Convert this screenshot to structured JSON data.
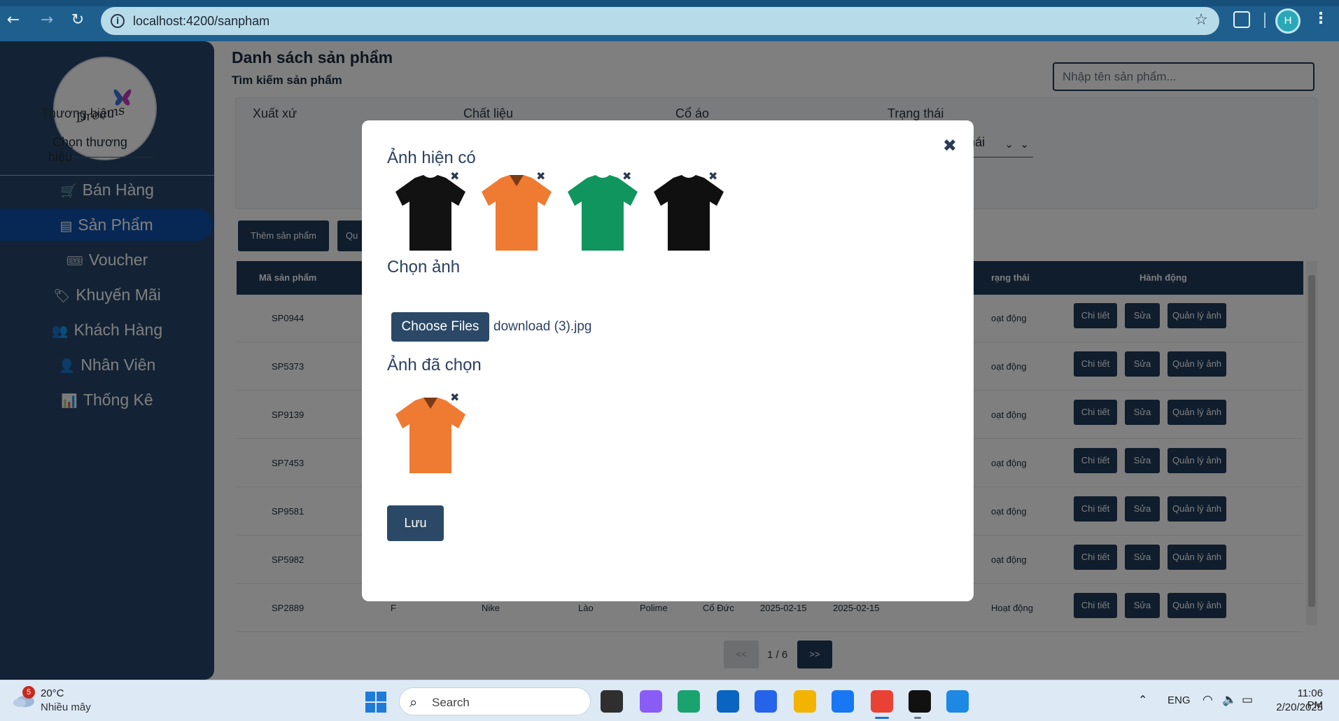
{
  "browser": {
    "url": "localhost:4200/sanpham",
    "profile_initial": "H"
  },
  "sidebar": {
    "logo_text": "Dreams",
    "items": [
      {
        "label": "Bán Hàng",
        "icon": "cart-icon",
        "glyph": "🛒"
      },
      {
        "label": "Sản Phẩm",
        "icon": "store-icon",
        "glyph": "▤"
      },
      {
        "label": "Voucher",
        "icon": "voucher-icon",
        "glyph": "🎟"
      },
      {
        "label": "Khuyến Mãi",
        "icon": "tag-icon",
        "glyph": "🏷"
      },
      {
        "label": "Khách Hàng",
        "icon": "users-icon",
        "glyph": "👥"
      },
      {
        "label": "Nhân Viên",
        "icon": "user-icon",
        "glyph": "👤"
      },
      {
        "label": "Thống Kê",
        "icon": "chart-icon",
        "glyph": "📊"
      }
    ],
    "active_index": 1
  },
  "page": {
    "title": "Danh sách sản phẩm",
    "subtitle": "Tìm kiếm sản phẩm",
    "search_placeholder": "Nhập tên sản phẩm...",
    "filters": [
      {
        "label": "Thương hiệu",
        "value": "Chọn thương hiệu"
      },
      {
        "label": "Xuất xứ",
        "value": ""
      },
      {
        "label": "Chất liệu",
        "value": ""
      },
      {
        "label": "Cổ áo",
        "value": ""
      },
      {
        "label": "Trạng thái",
        "value": "Chọn trạng thái"
      }
    ],
    "actions": [
      "Thêm sản phẩm",
      "Qu"
    ],
    "table_headers": [
      "Mã sản phẩm",
      "rạng thái",
      "Hành động"
    ],
    "rows": [
      {
        "code": "SP0944",
        "status": "oạt động"
      },
      {
        "code": "SP5373",
        "status": "oạt động"
      },
      {
        "code": "SP9139",
        "status": "oạt động"
      },
      {
        "code": "SP7453",
        "status": "oạt động"
      },
      {
        "code": "SP9581",
        "status": "oạt động"
      },
      {
        "code": "SP5982",
        "status": "oạt động"
      },
      {
        "code": "SP2889",
        "name": "F",
        "brand": "Nike",
        "origin": "Lào",
        "material": "Polime",
        "collar": "Cổ Đức",
        "created": "2025-02-15",
        "updated": "2025-02-15",
        "status": "Hoạt động"
      }
    ],
    "row_buttons": {
      "detail": "Chi tiết",
      "edit": "Sửa",
      "images": "Quản lý ảnh"
    },
    "pager": {
      "prev": "<<",
      "info": "1 / 6",
      "next": ">>"
    }
  },
  "modal": {
    "existing_heading": "Ảnh hiện có",
    "existing_images": [
      {
        "desc": "black t-shirt",
        "color": "#121212"
      },
      {
        "desc": "orange polo shirt",
        "color": "#ef7a32"
      },
      {
        "desc": "green t-shirt",
        "color": "#11955f"
      },
      {
        "desc": "black t-shirt",
        "color": "#101010"
      }
    ],
    "choose_heading": "Chọn ảnh",
    "choose_button": "Choose Files",
    "file_name": "download (3).jpg",
    "selected_heading": "Ảnh đã chọn",
    "selected_images": [
      {
        "desc": "orange polo shirt",
        "color": "#ef7a32"
      }
    ],
    "save_label": "Lưu",
    "close_glyph": "✖"
  },
  "taskbar": {
    "weather_badge": "5",
    "temperature": "20°C",
    "weather_desc": "Nhiều mây",
    "search_label": "Search",
    "language": "ENG",
    "time": "11:06 PM",
    "date": "2/20/2025",
    "apps": [
      "file-explorer-dark-icon",
      "copilot-icon",
      "edge-icon",
      "outlook-icon",
      "store-icon",
      "folder-icon",
      "facebook-icon",
      "chrome-icon",
      "intellij-icon",
      "vscode-icon"
    ]
  }
}
